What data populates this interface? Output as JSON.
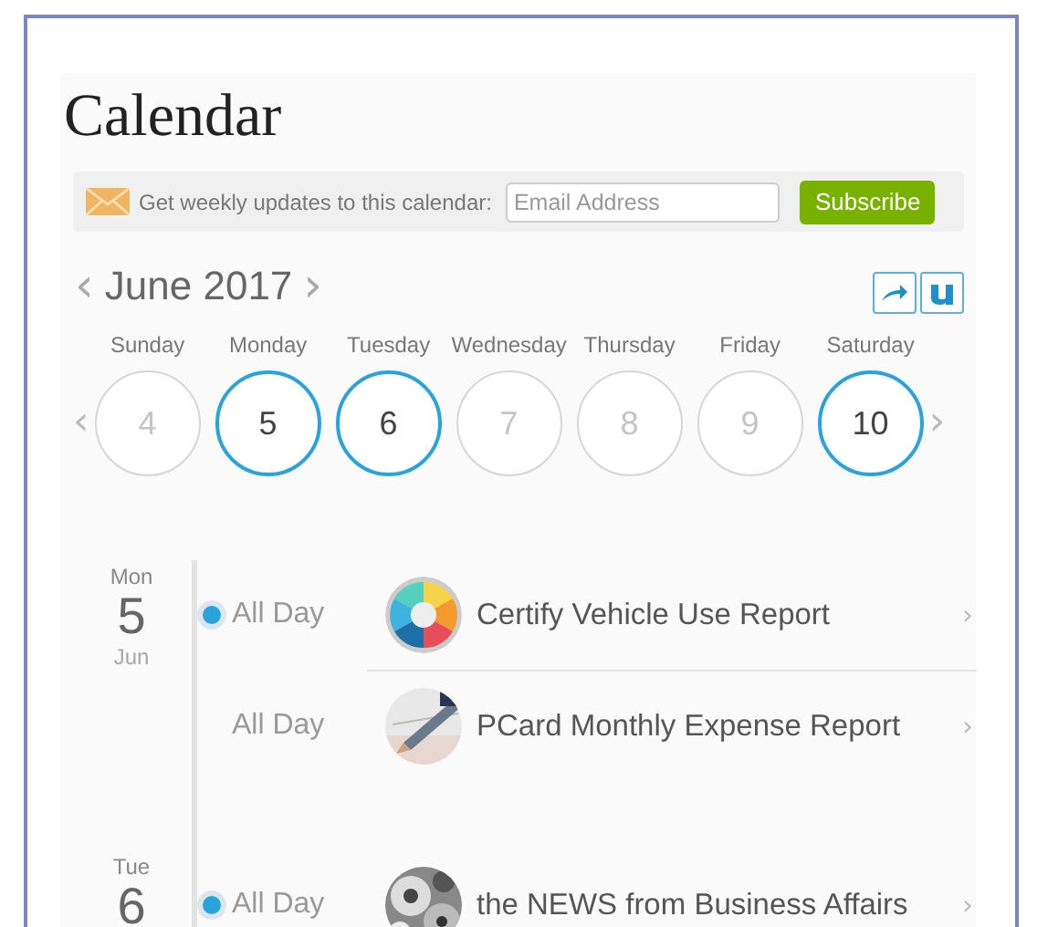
{
  "title": "Calendar",
  "subscribe": {
    "label": "Get weekly updates to this calendar:",
    "placeholder": "Email Address",
    "button": "Subscribe"
  },
  "month": {
    "label": "June 2017",
    "prev": "‹",
    "next": "›"
  },
  "week": {
    "prev": "‹",
    "next": "›",
    "days": [
      {
        "weekday": "Sunday",
        "date": "4",
        "has_events": false
      },
      {
        "weekday": "Monday",
        "date": "5",
        "has_events": true
      },
      {
        "weekday": "Tuesday",
        "date": "6",
        "has_events": true
      },
      {
        "weekday": "Wednesday",
        "date": "7",
        "has_events": false
      },
      {
        "weekday": "Thursday",
        "date": "8",
        "has_events": false
      },
      {
        "weekday": "Friday",
        "date": "9",
        "has_events": false
      },
      {
        "weekday": "Saturday",
        "date": "10",
        "has_events": true
      }
    ]
  },
  "agenda": [
    {
      "weekday": "Mon",
      "date": "5",
      "month": "Jun",
      "events": [
        {
          "time": "All Day",
          "title": "Certify Vehicle Use Report",
          "chevron": "›"
        },
        {
          "time": "All Day",
          "title": "PCard Monthly Expense Report",
          "chevron": "›"
        }
      ]
    },
    {
      "weekday": "Tue",
      "date": "6",
      "events": [
        {
          "time": "All Day",
          "title": "the NEWS from Business Affairs",
          "chevron": "›"
        }
      ]
    }
  ]
}
